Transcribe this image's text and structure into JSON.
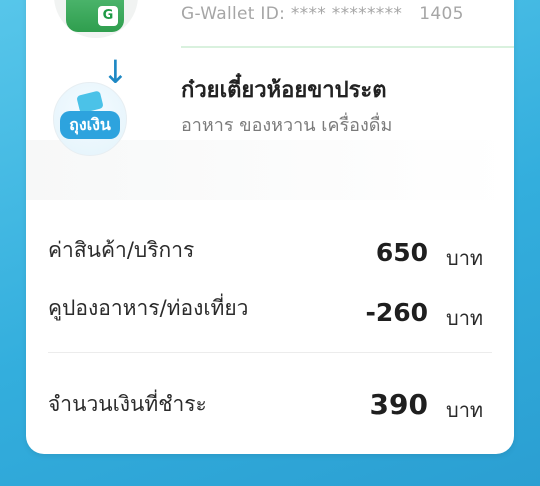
{
  "wallet": {
    "id_text": "G-Wallet ID: **** ********   1405",
    "icon": "g-wallet-icon",
    "icon_letter": "G"
  },
  "arrow": "arrow-down-icon",
  "merchant": {
    "name": "ก๋วยเตี๋ยวห้อยขาประต",
    "category": "อาหาร ของหวาน เครื่องดื่ม",
    "logo_text": "ถุงเงิน"
  },
  "summary": {
    "items": [
      {
        "label": "ค่าสินค้า/บริการ",
        "amount": "650",
        "unit": "บาท"
      },
      {
        "label": "คูปองอาหาร/ท่องเที่ยว",
        "amount": "-260",
        "unit": "บาท"
      }
    ],
    "total": {
      "label": "จำนวนเงินที่ชำระ",
      "amount": "390",
      "unit": "บาท"
    }
  },
  "colors": {
    "background": "#33aedd",
    "card": "#ffffff",
    "arrow": "#1e88c4",
    "wallet_green": "#2f9e4e"
  }
}
